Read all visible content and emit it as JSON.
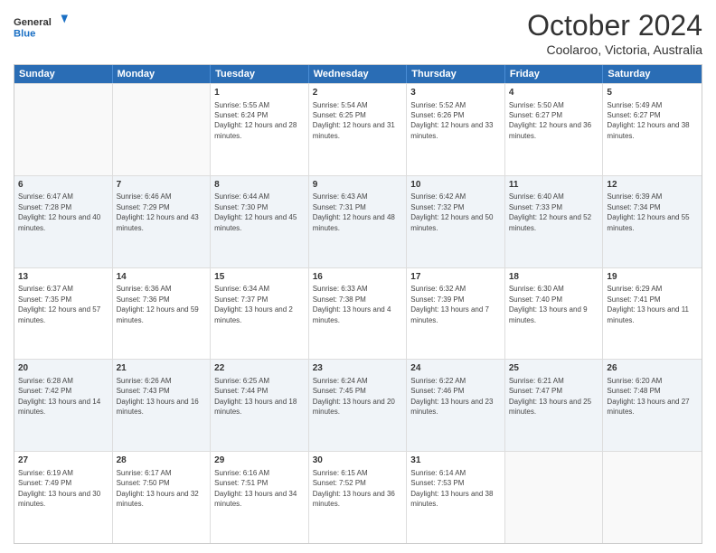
{
  "logo": {
    "general": "General",
    "blue": "Blue"
  },
  "header": {
    "month": "October 2024",
    "location": "Coolaroo, Victoria, Australia"
  },
  "weekdays": [
    "Sunday",
    "Monday",
    "Tuesday",
    "Wednesday",
    "Thursday",
    "Friday",
    "Saturday"
  ],
  "weeks": [
    [
      {
        "day": "",
        "sunrise": "",
        "sunset": "",
        "daylight": "",
        "empty": true
      },
      {
        "day": "",
        "sunrise": "",
        "sunset": "",
        "daylight": "",
        "empty": true
      },
      {
        "day": "1",
        "sunrise": "Sunrise: 5:55 AM",
        "sunset": "Sunset: 6:24 PM",
        "daylight": "Daylight: 12 hours and 28 minutes.",
        "empty": false
      },
      {
        "day": "2",
        "sunrise": "Sunrise: 5:54 AM",
        "sunset": "Sunset: 6:25 PM",
        "daylight": "Daylight: 12 hours and 31 minutes.",
        "empty": false
      },
      {
        "day": "3",
        "sunrise": "Sunrise: 5:52 AM",
        "sunset": "Sunset: 6:26 PM",
        "daylight": "Daylight: 12 hours and 33 minutes.",
        "empty": false
      },
      {
        "day": "4",
        "sunrise": "Sunrise: 5:50 AM",
        "sunset": "Sunset: 6:27 PM",
        "daylight": "Daylight: 12 hours and 36 minutes.",
        "empty": false
      },
      {
        "day": "5",
        "sunrise": "Sunrise: 5:49 AM",
        "sunset": "Sunset: 6:27 PM",
        "daylight": "Daylight: 12 hours and 38 minutes.",
        "empty": false
      }
    ],
    [
      {
        "day": "6",
        "sunrise": "Sunrise: 6:47 AM",
        "sunset": "Sunset: 7:28 PM",
        "daylight": "Daylight: 12 hours and 40 minutes.",
        "empty": false
      },
      {
        "day": "7",
        "sunrise": "Sunrise: 6:46 AM",
        "sunset": "Sunset: 7:29 PM",
        "daylight": "Daylight: 12 hours and 43 minutes.",
        "empty": false
      },
      {
        "day": "8",
        "sunrise": "Sunrise: 6:44 AM",
        "sunset": "Sunset: 7:30 PM",
        "daylight": "Daylight: 12 hours and 45 minutes.",
        "empty": false
      },
      {
        "day": "9",
        "sunrise": "Sunrise: 6:43 AM",
        "sunset": "Sunset: 7:31 PM",
        "daylight": "Daylight: 12 hours and 48 minutes.",
        "empty": false
      },
      {
        "day": "10",
        "sunrise": "Sunrise: 6:42 AM",
        "sunset": "Sunset: 7:32 PM",
        "daylight": "Daylight: 12 hours and 50 minutes.",
        "empty": false
      },
      {
        "day": "11",
        "sunrise": "Sunrise: 6:40 AM",
        "sunset": "Sunset: 7:33 PM",
        "daylight": "Daylight: 12 hours and 52 minutes.",
        "empty": false
      },
      {
        "day": "12",
        "sunrise": "Sunrise: 6:39 AM",
        "sunset": "Sunset: 7:34 PM",
        "daylight": "Daylight: 12 hours and 55 minutes.",
        "empty": false
      }
    ],
    [
      {
        "day": "13",
        "sunrise": "Sunrise: 6:37 AM",
        "sunset": "Sunset: 7:35 PM",
        "daylight": "Daylight: 12 hours and 57 minutes.",
        "empty": false
      },
      {
        "day": "14",
        "sunrise": "Sunrise: 6:36 AM",
        "sunset": "Sunset: 7:36 PM",
        "daylight": "Daylight: 12 hours and 59 minutes.",
        "empty": false
      },
      {
        "day": "15",
        "sunrise": "Sunrise: 6:34 AM",
        "sunset": "Sunset: 7:37 PM",
        "daylight": "Daylight: 13 hours and 2 minutes.",
        "empty": false
      },
      {
        "day": "16",
        "sunrise": "Sunrise: 6:33 AM",
        "sunset": "Sunset: 7:38 PM",
        "daylight": "Daylight: 13 hours and 4 minutes.",
        "empty": false
      },
      {
        "day": "17",
        "sunrise": "Sunrise: 6:32 AM",
        "sunset": "Sunset: 7:39 PM",
        "daylight": "Daylight: 13 hours and 7 minutes.",
        "empty": false
      },
      {
        "day": "18",
        "sunrise": "Sunrise: 6:30 AM",
        "sunset": "Sunset: 7:40 PM",
        "daylight": "Daylight: 13 hours and 9 minutes.",
        "empty": false
      },
      {
        "day": "19",
        "sunrise": "Sunrise: 6:29 AM",
        "sunset": "Sunset: 7:41 PM",
        "daylight": "Daylight: 13 hours and 11 minutes.",
        "empty": false
      }
    ],
    [
      {
        "day": "20",
        "sunrise": "Sunrise: 6:28 AM",
        "sunset": "Sunset: 7:42 PM",
        "daylight": "Daylight: 13 hours and 14 minutes.",
        "empty": false
      },
      {
        "day": "21",
        "sunrise": "Sunrise: 6:26 AM",
        "sunset": "Sunset: 7:43 PM",
        "daylight": "Daylight: 13 hours and 16 minutes.",
        "empty": false
      },
      {
        "day": "22",
        "sunrise": "Sunrise: 6:25 AM",
        "sunset": "Sunset: 7:44 PM",
        "daylight": "Daylight: 13 hours and 18 minutes.",
        "empty": false
      },
      {
        "day": "23",
        "sunrise": "Sunrise: 6:24 AM",
        "sunset": "Sunset: 7:45 PM",
        "daylight": "Daylight: 13 hours and 20 minutes.",
        "empty": false
      },
      {
        "day": "24",
        "sunrise": "Sunrise: 6:22 AM",
        "sunset": "Sunset: 7:46 PM",
        "daylight": "Daylight: 13 hours and 23 minutes.",
        "empty": false
      },
      {
        "day": "25",
        "sunrise": "Sunrise: 6:21 AM",
        "sunset": "Sunset: 7:47 PM",
        "daylight": "Daylight: 13 hours and 25 minutes.",
        "empty": false
      },
      {
        "day": "26",
        "sunrise": "Sunrise: 6:20 AM",
        "sunset": "Sunset: 7:48 PM",
        "daylight": "Daylight: 13 hours and 27 minutes.",
        "empty": false
      }
    ],
    [
      {
        "day": "27",
        "sunrise": "Sunrise: 6:19 AM",
        "sunset": "Sunset: 7:49 PM",
        "daylight": "Daylight: 13 hours and 30 minutes.",
        "empty": false
      },
      {
        "day": "28",
        "sunrise": "Sunrise: 6:17 AM",
        "sunset": "Sunset: 7:50 PM",
        "daylight": "Daylight: 13 hours and 32 minutes.",
        "empty": false
      },
      {
        "day": "29",
        "sunrise": "Sunrise: 6:16 AM",
        "sunset": "Sunset: 7:51 PM",
        "daylight": "Daylight: 13 hours and 34 minutes.",
        "empty": false
      },
      {
        "day": "30",
        "sunrise": "Sunrise: 6:15 AM",
        "sunset": "Sunset: 7:52 PM",
        "daylight": "Daylight: 13 hours and 36 minutes.",
        "empty": false
      },
      {
        "day": "31",
        "sunrise": "Sunrise: 6:14 AM",
        "sunset": "Sunset: 7:53 PM",
        "daylight": "Daylight: 13 hours and 38 minutes.",
        "empty": false
      },
      {
        "day": "",
        "sunrise": "",
        "sunset": "",
        "daylight": "",
        "empty": true
      },
      {
        "day": "",
        "sunrise": "",
        "sunset": "",
        "daylight": "",
        "empty": true
      }
    ]
  ]
}
